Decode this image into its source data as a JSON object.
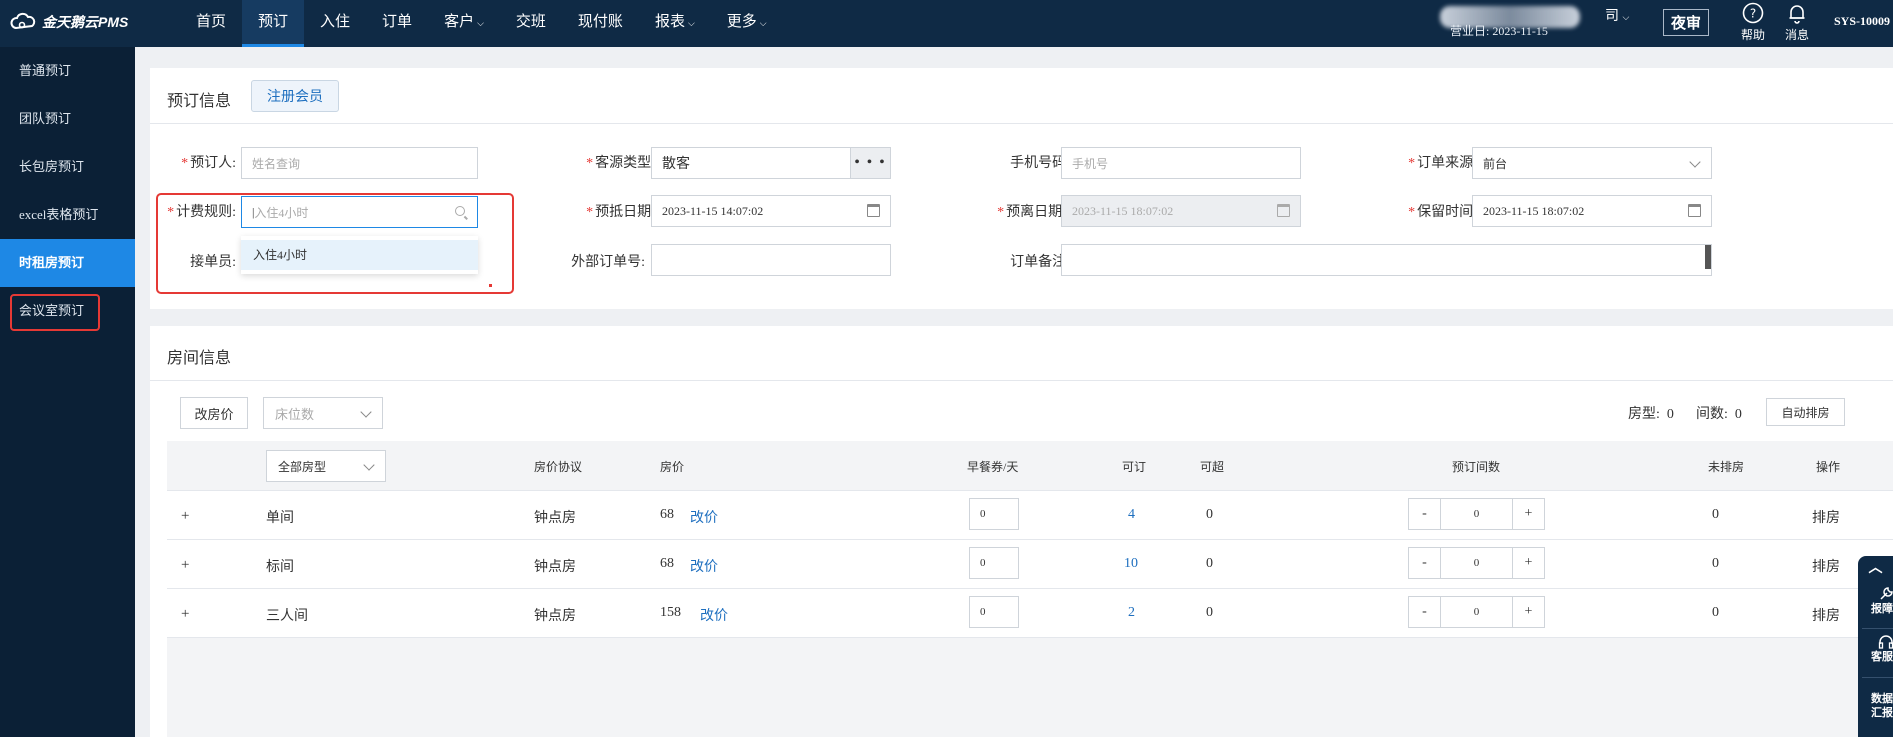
{
  "app": {
    "logo_text": "金天鹅云PMS"
  },
  "nav": {
    "items": [
      {
        "label": "首页",
        "caret": false
      },
      {
        "label": "预订",
        "caret": false,
        "active": true
      },
      {
        "label": "入住",
        "caret": false
      },
      {
        "label": "订单",
        "caret": false
      },
      {
        "label": "客户",
        "caret": true
      },
      {
        "label": "交班",
        "caret": false
      },
      {
        "label": "现付账",
        "caret": false
      },
      {
        "label": "报表",
        "caret": true
      },
      {
        "label": "更多",
        "caret": true
      }
    ]
  },
  "header": {
    "hotel_suffix": "司",
    "business_day": "营业日: 2023-11-15",
    "night_audit": "夜审",
    "help": "帮助",
    "messages": "消息",
    "sys_id": "SYS-10009"
  },
  "sidebar": {
    "items": [
      {
        "label": "普通预订"
      },
      {
        "label": "团队预订"
      },
      {
        "label": "长包房预订"
      },
      {
        "label": "excel表格预订"
      },
      {
        "label": "时租房预订",
        "active": true
      },
      {
        "label": "会议室预订"
      }
    ]
  },
  "booking": {
    "title": "预订信息",
    "register_member": "注册会员",
    "booker_label": "预订人:",
    "booker_placeholder": "姓名查询",
    "source_type_label": "客源类型:",
    "source_type_value": "散客",
    "source_more": "• • •",
    "phone_label": "手机号码:",
    "phone_placeholder": "手机号",
    "order_source_label": "订单来源:",
    "order_source_value": "前台",
    "billing_rule_label": "计费规则:",
    "billing_rule_placeholder": "入住4小时",
    "arrival_label": "预抵日期:",
    "arrival_value": "2023-11-15 14:07:02",
    "departure_label": "预离日期:",
    "departure_value": "2023-11-15 18:07:02",
    "hold_label": "保留时间:",
    "hold_value": "2023-11-15 18:07:02",
    "receiver_label": "接单员:",
    "external_order_label": "外部订单号:",
    "remark_label": "订单备注:",
    "dropdown_option": "入住4小时"
  },
  "rooms": {
    "title": "房间信息",
    "change_price": "改房价",
    "bed_count_placeholder": "床位数",
    "room_type_label": "房型:",
    "room_type_count": "0",
    "room_count_label": "间数:",
    "room_count": "0",
    "auto_assign": "自动排房",
    "all_room_types": "全部房型",
    "columns": {
      "agreement": "房价协议",
      "price": "房价",
      "breakfast": "早餐券/天",
      "available": "可订",
      "overbook": "可超",
      "book_count": "预订间数",
      "unassigned": "未排房",
      "action": "操作"
    },
    "rows": [
      {
        "name": "单间",
        "agreement": "钟点房",
        "price": "68",
        "edit": "改价",
        "breakfast": "0",
        "available": "4",
        "overbook": "0",
        "book": "0",
        "unassigned": "0",
        "action": "排房"
      },
      {
        "name": "标间",
        "agreement": "钟点房",
        "price": "68",
        "edit": "改价",
        "breakfast": "0",
        "available": "10",
        "overbook": "0",
        "book": "0",
        "unassigned": "0",
        "action": "排房"
      },
      {
        "name": "三人间",
        "agreement": "钟点房",
        "price": "158",
        "edit": "改价",
        "breakfast": "0",
        "available": "2",
        "overbook": "0",
        "book": "0",
        "unassigned": "0",
        "action": "排房"
      }
    ],
    "stepper_minus": "-",
    "stepper_plus": "+",
    "expand": "+"
  },
  "float_tools": {
    "report": "报障",
    "service": "客服",
    "data_l1": "数据",
    "data_l2": "汇报"
  },
  "colors": {
    "topbar": "#0f2a45",
    "sidebar": "#0b2036",
    "accent": "#1e88e5",
    "highlight": "#e53935"
  }
}
